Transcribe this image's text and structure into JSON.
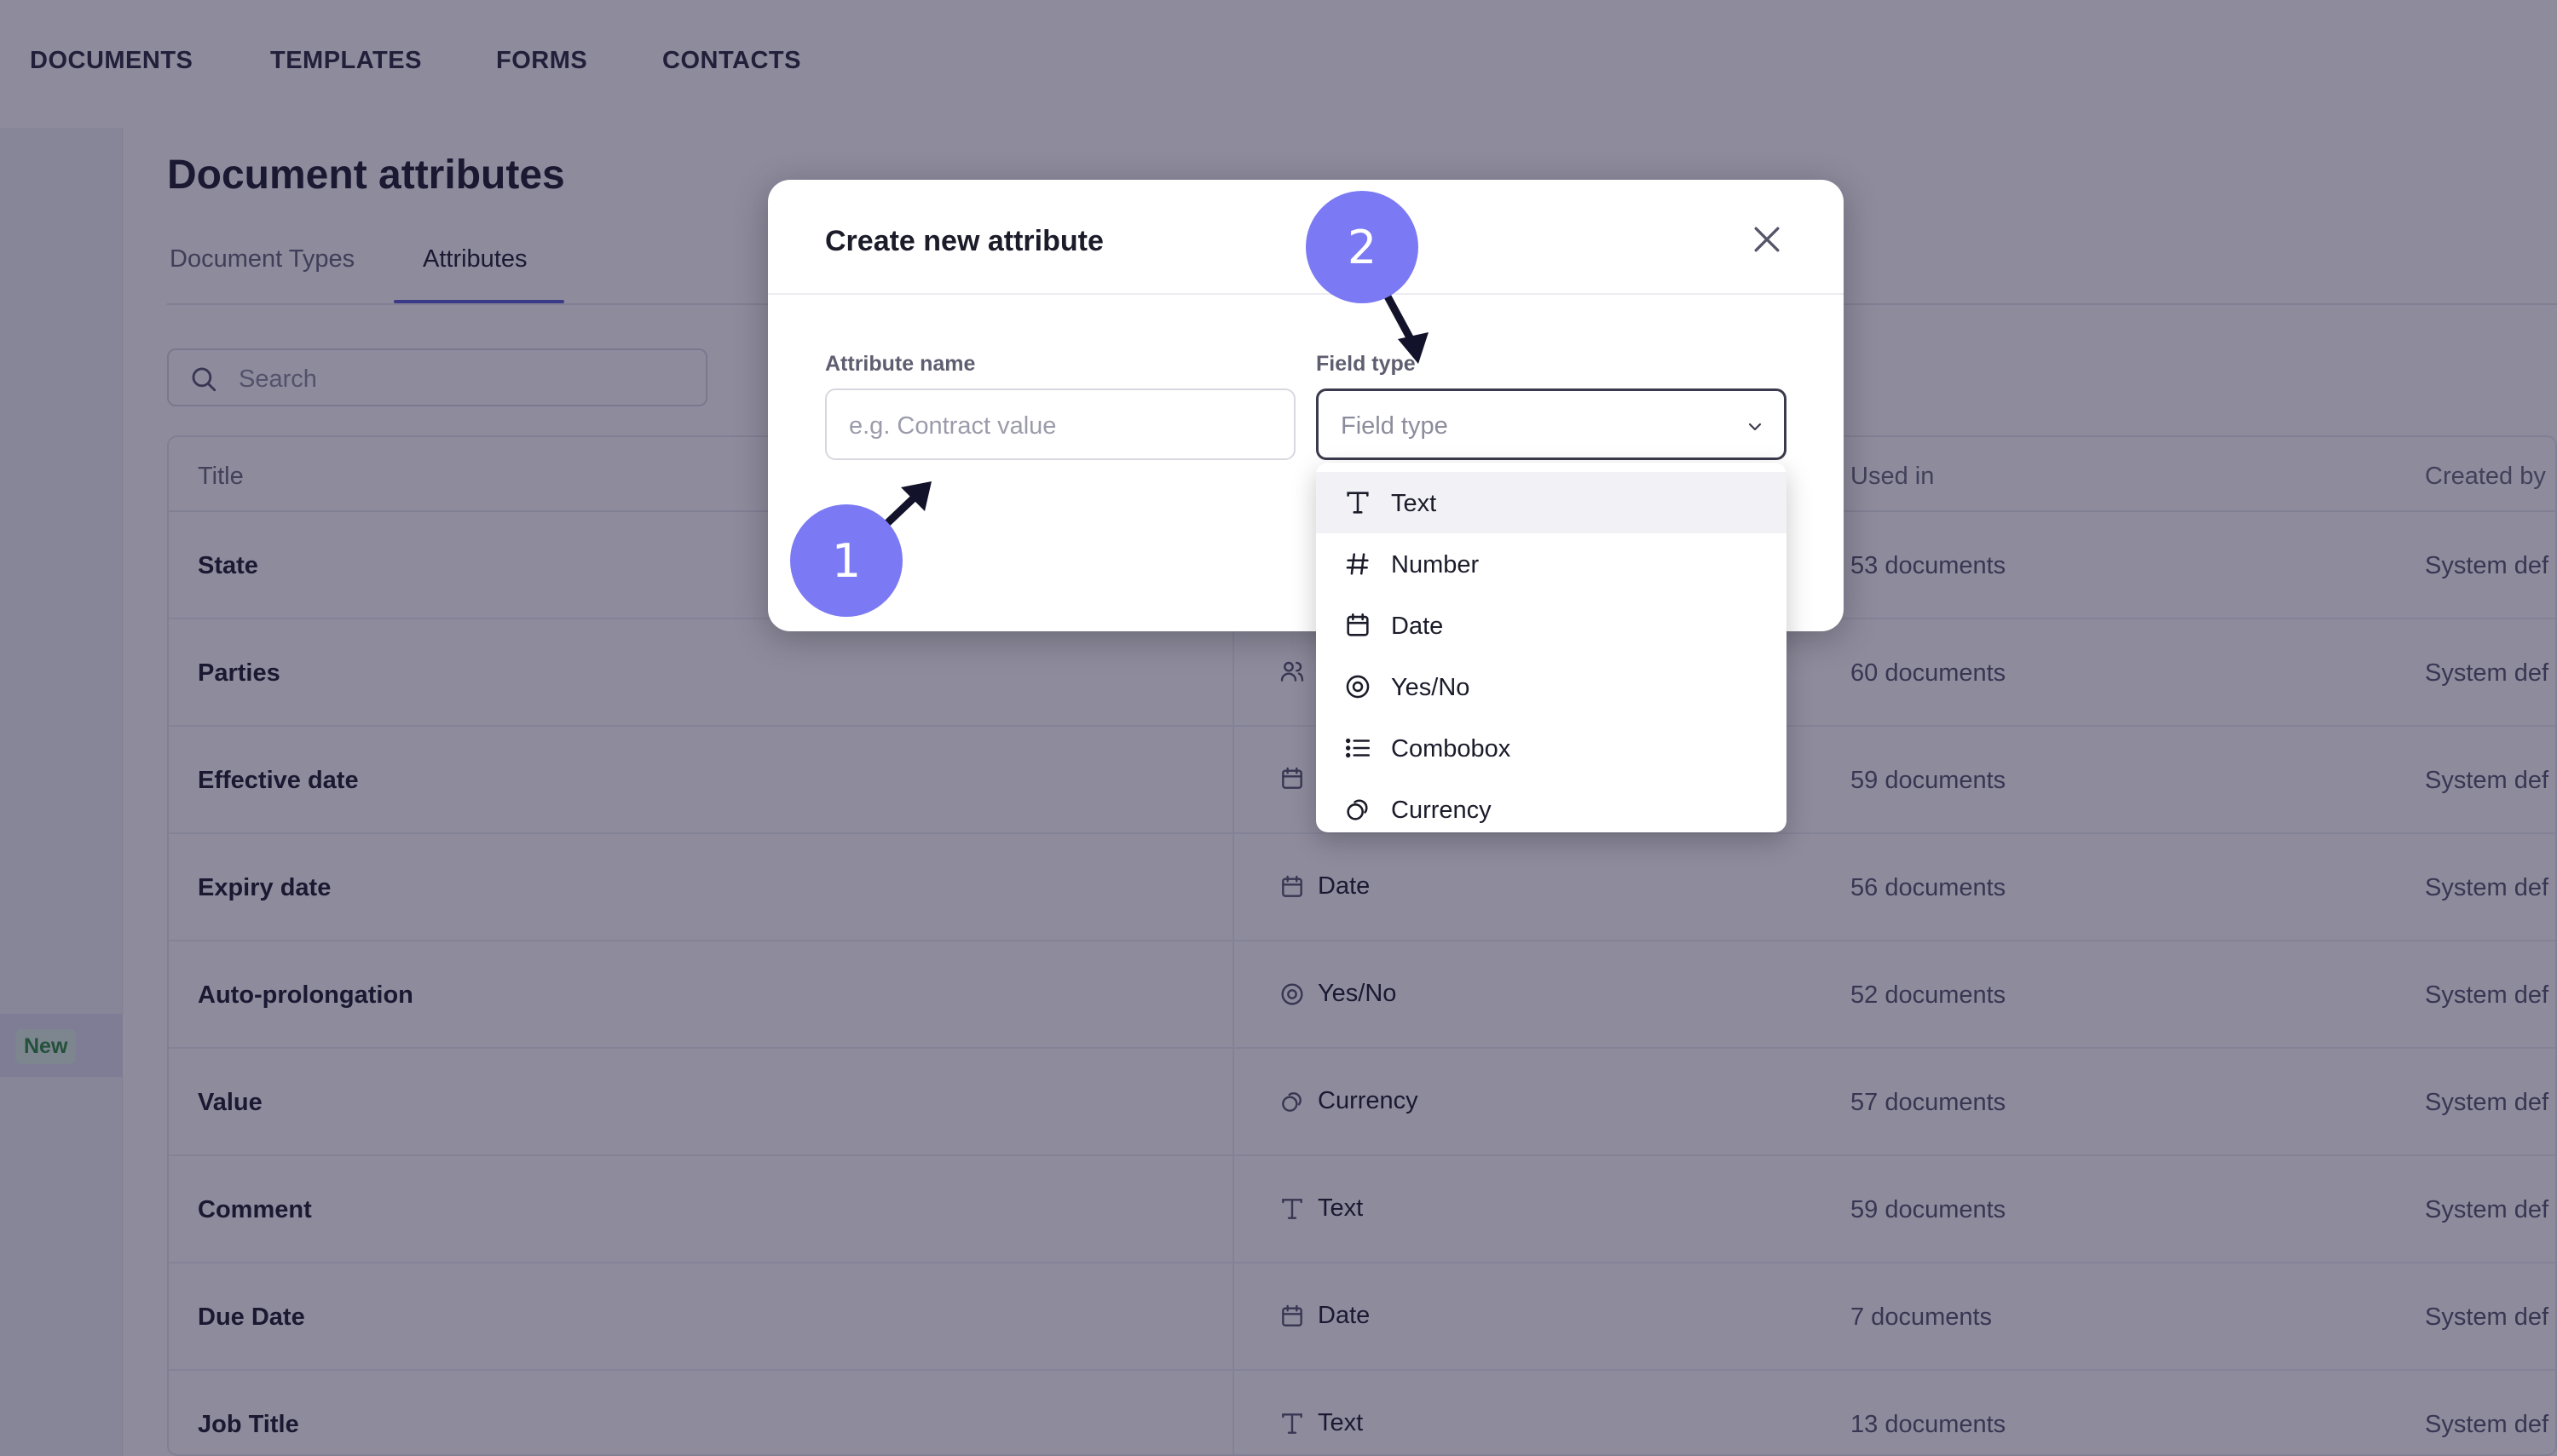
{
  "nav": {
    "items": [
      "DOCUMENTS",
      "TEMPLATES",
      "FORMS",
      "CONTACTS"
    ]
  },
  "sidebar": {
    "new_badge": "New"
  },
  "page": {
    "title": "Document attributes",
    "tabs": [
      "Document Types",
      "Attributes"
    ],
    "active_tab": "Attributes",
    "search_placeholder": "Search"
  },
  "table": {
    "columns": [
      "Title",
      "Used in",
      "Created by"
    ],
    "rows": [
      {
        "title": "State",
        "type": "",
        "type_icon": "",
        "used_in": "53 documents",
        "created_by": "System def"
      },
      {
        "title": "Parties",
        "type": "",
        "type_icon": "people-icon",
        "used_in": "60 documents",
        "created_by": "System def"
      },
      {
        "title": "Effective date",
        "type": "",
        "type_icon": "calendar-icon",
        "used_in": "59 documents",
        "created_by": "System def"
      },
      {
        "title": "Expiry date",
        "type": "Date",
        "type_icon": "calendar-icon",
        "used_in": "56 documents",
        "created_by": "System def"
      },
      {
        "title": "Auto-prolongation",
        "type": "Yes/No",
        "type_icon": "radio-icon",
        "used_in": "52 documents",
        "created_by": "System def"
      },
      {
        "title": "Value",
        "type": "Currency",
        "type_icon": "currency-icon",
        "used_in": "57 documents",
        "created_by": "System def"
      },
      {
        "title": "Comment",
        "type": "Text",
        "type_icon": "text-icon",
        "used_in": "59 documents",
        "created_by": "System def"
      },
      {
        "title": "Due Date",
        "type": "Date",
        "type_icon": "calendar-icon",
        "used_in": "7 documents",
        "created_by": "System def"
      },
      {
        "title": "Job Title",
        "type": "Text",
        "type_icon": "text-icon",
        "used_in": "13 documents",
        "created_by": "System def"
      }
    ]
  },
  "modal": {
    "title": "Create new attribute",
    "name_label": "Attribute name",
    "name_placeholder": "e.g. Contract value",
    "type_label": "Field type",
    "type_placeholder": "Field type",
    "options": [
      {
        "label": "Text",
        "icon": "text-icon"
      },
      {
        "label": "Number",
        "icon": "hash-icon"
      },
      {
        "label": "Date",
        "icon": "calendar-icon"
      },
      {
        "label": "Yes/No",
        "icon": "radio-icon"
      },
      {
        "label": "Combobox",
        "icon": "list-icon"
      },
      {
        "label": "Currency",
        "icon": "currency-icon"
      }
    ]
  },
  "steps": [
    "1",
    "2"
  ],
  "colors": {
    "accent": "#5f5bd8",
    "step_marker": "#7b79f3",
    "overlay": "#1c183a",
    "new_badge_bg": "#dff3e3",
    "new_badge_text": "#2b8a3e"
  }
}
